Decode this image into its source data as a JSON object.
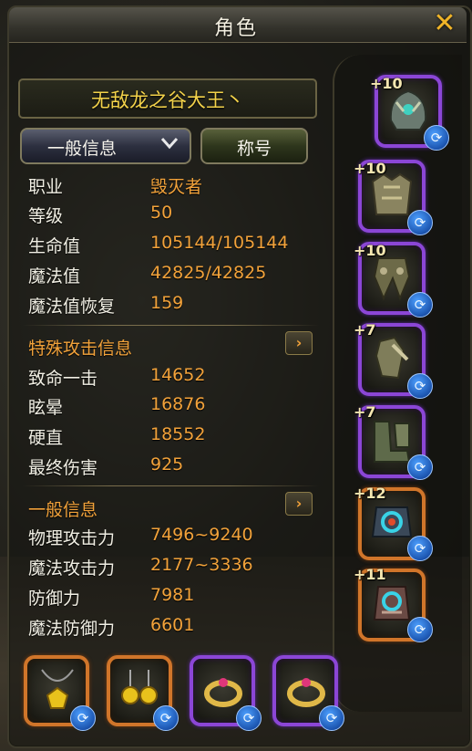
{
  "window": {
    "title": "角色",
    "close_icon": "close-icon"
  },
  "character": {
    "name": "无敌龙之谷大王丶"
  },
  "controls": {
    "dropdown_label": "一般信息",
    "title_button": "称号"
  },
  "basic_stats": [
    {
      "label": "职业",
      "value": "毁灭者"
    },
    {
      "label": "等级",
      "value": "50"
    },
    {
      "label": "生命值",
      "value": "105144/105144"
    },
    {
      "label": "魔法值",
      "value": "42825/42825"
    },
    {
      "label": "魔法值恢复",
      "value": "159"
    }
  ],
  "special_attack": {
    "heading": "特殊攻击信息",
    "stats": [
      {
        "label": "致命一击",
        "value": "14652"
      },
      {
        "label": "眩晕",
        "value": "16876"
      },
      {
        "label": "硬直",
        "value": "18552"
      },
      {
        "label": "最终伤害",
        "value": "925"
      }
    ]
  },
  "general_info": {
    "heading": "一般信息",
    "stats": [
      {
        "label": "物理攻击力",
        "value": "7496~9240"
      },
      {
        "label": "魔法攻击力",
        "value": "2177~3336"
      },
      {
        "label": "防御力",
        "value": "7981"
      },
      {
        "label": "魔法防御力",
        "value": "6601"
      }
    ]
  },
  "equipment": [
    {
      "slot": "helmet",
      "enhance": "+10",
      "rarity": "purple"
    },
    {
      "slot": "chest",
      "enhance": "+10",
      "rarity": "purple"
    },
    {
      "slot": "legs",
      "enhance": "+10",
      "rarity": "purple"
    },
    {
      "slot": "gloves",
      "enhance": "+7",
      "rarity": "purple"
    },
    {
      "slot": "boots",
      "enhance": "+7",
      "rarity": "purple"
    },
    {
      "slot": "main-weapon",
      "enhance": "+12",
      "rarity": "orange"
    },
    {
      "slot": "off-weapon",
      "enhance": "+11",
      "rarity": "orange"
    }
  ],
  "accessories": [
    {
      "slot": "necklace",
      "rarity": "orange"
    },
    {
      "slot": "earring",
      "rarity": "orange"
    },
    {
      "slot": "ring-1",
      "rarity": "purple"
    },
    {
      "slot": "ring-2",
      "rarity": "purple"
    }
  ],
  "colors": {
    "accent": "#f2a23a",
    "name": "#f3d24a",
    "purple": "#8b46d6",
    "orange": "#d0752a"
  }
}
